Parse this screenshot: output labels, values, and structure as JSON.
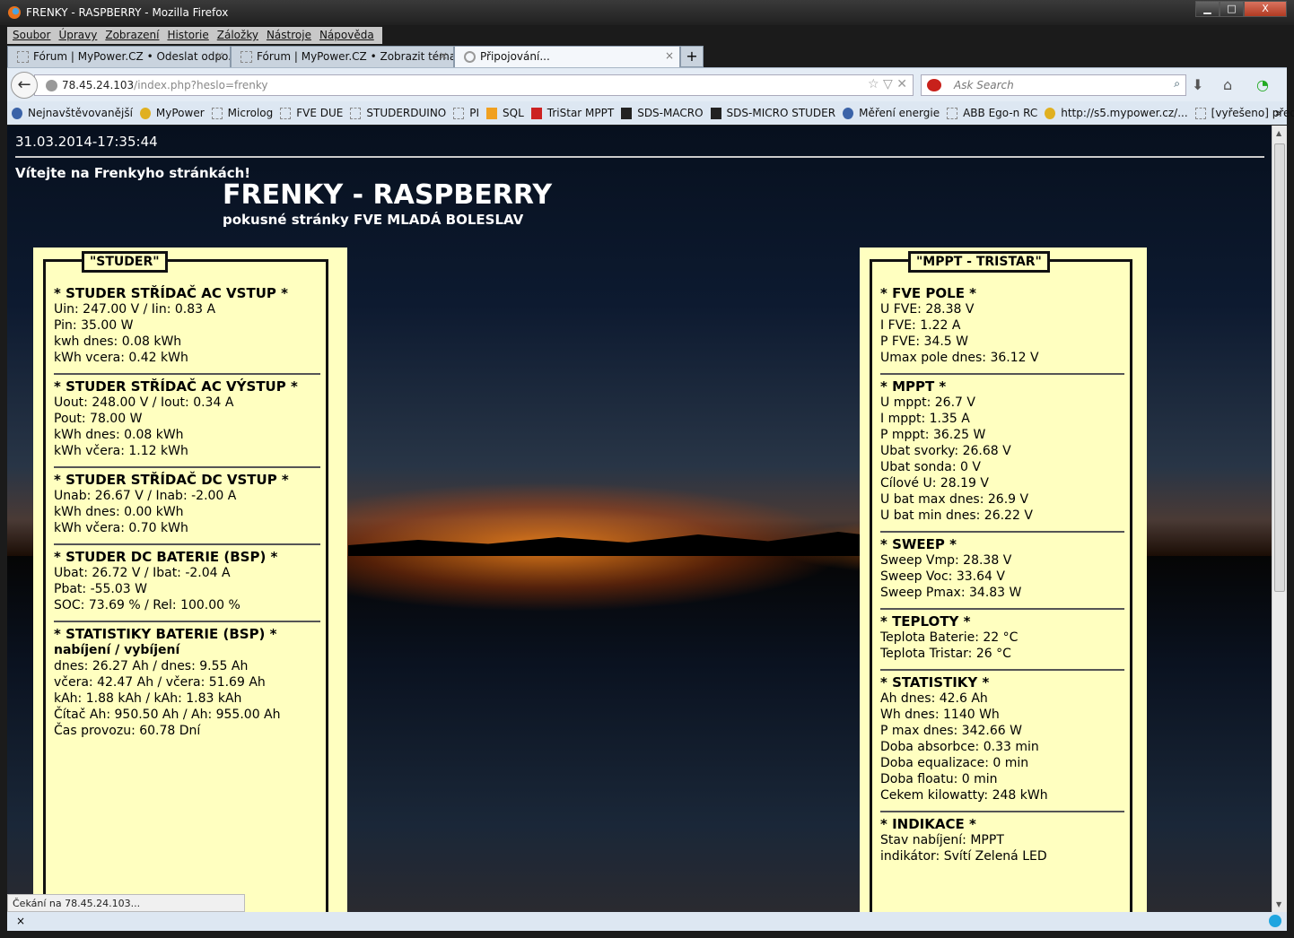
{
  "window": {
    "title": "FRENKY - RASPBERRY - Mozilla Firefox"
  },
  "menu": [
    "Soubor",
    "Úpravy",
    "Zobrazení",
    "Historie",
    "Záložky",
    "Nástroje",
    "Nápověda"
  ],
  "tabs": [
    {
      "label": "Fórum | MyPower.CZ • Odeslat odpo..."
    },
    {
      "label": "Fórum | MyPower.CZ • Zobrazit téma..."
    },
    {
      "label": "Připojování..."
    }
  ],
  "address": {
    "host": "78.45.24.103",
    "path": "/index.php?heslo=frenky"
  },
  "search": {
    "placeholder": "Ask Search"
  },
  "bookmarks": [
    "Nejnavštěvovanější",
    "MyPower",
    "Microlog",
    "FVE DUE",
    "STUDERDUINO",
    "PI",
    "SQL",
    "TriStar MPPT",
    "SDS-MACRO",
    "SDS-MICRO STUDER",
    "Měření energie",
    "ABB Ego-n RC",
    "http://s5.mypower.cz/...",
    "[vyřešeno] předávání d..."
  ],
  "page": {
    "datetime": "31.03.2014-17:35:44",
    "welcome": "Vítejte na Frenkyho stránkách!",
    "title": "FRENKY - RASPBERRY",
    "subtitle": "pokusné stránky FVE MLADÁ BOLESLAV",
    "studer": {
      "legend": "\"STUDER\"",
      "sections": [
        {
          "title": "* STUDER STŘÍDAČ AC VSTUP *",
          "lines": [
            "Uin: 247.00 V / Iin: 0.83 A",
            "Pin: 35.00 W",
            "kwh dnes: 0.08 kWh",
            "kWh vcera: 0.42 kWh"
          ]
        },
        {
          "title": "* STUDER STŘÍDAČ AC VÝSTUP *",
          "lines": [
            "Uout: 248.00 V / Iout: 0.34 A",
            "Pout: 78.00 W",
            "kWh dnes: 0.08 kWh",
            "kWh včera: 1.12 kWh"
          ]
        },
        {
          "title": "* STUDER STŘÍDAČ DC VSTUP *",
          "lines": [
            "Unab: 26.67 V / Inab: -2.00 A",
            "kWh dnes: 0.00 kWh",
            "kWh včera: 0.70 kWh"
          ]
        },
        {
          "title": "* STUDER DC BATERIE (BSP) *",
          "lines": [
            "Ubat: 26.72 V / Ibat: -2.04 A",
            "Pbat: -55.03 W",
            "SOC: 73.69 % / Rel: 100.00 %"
          ]
        },
        {
          "title": "* STATISTIKY BATERIE (BSP) *",
          "bold": "nabíjení / vybíjení",
          "lines": [
            "dnes: 26.27 Ah / dnes: 9.55 Ah",
            "včera: 42.47 Ah / včera: 51.69 Ah",
            "kAh: 1.88 kAh / kAh: 1.83 kAh",
            "Čítač Ah: 950.50 Ah / Ah: 955.00 Ah",
            "Čas provozu: 60.78 Dní"
          ]
        }
      ]
    },
    "tristar": {
      "legend": "\"MPPT - TRISTAR\"",
      "sections": [
        {
          "title": "* FVE POLE *",
          "lines": [
            "U FVE: 28.38 V",
            "I FVE: 1.22 A",
            "P FVE: 34.5 W",
            "Umax pole dnes: 36.12 V"
          ]
        },
        {
          "title": "* MPPT *",
          "lines": [
            "U mppt: 26.7 V",
            "I mppt: 1.35 A",
            "P mppt: 36.25 W",
            "Ubat svorky: 26.68 V",
            "Ubat sonda: 0 V",
            "Cílové U: 28.19 V",
            "U bat max dnes: 26.9 V",
            "U bat min dnes: 26.22 V"
          ]
        },
        {
          "title": "* SWEEP *",
          "lines": [
            "Sweep Vmp: 28.38 V",
            "Sweep Voc: 33.64 V",
            "Sweep Pmax: 34.83 W"
          ]
        },
        {
          "title": "* TEPLOTY *",
          "lines": [
            "Teplota Baterie: 22 °C",
            "Teplota Tristar: 26 °C"
          ]
        },
        {
          "title": "* STATISTIKY *",
          "lines": [
            "Ah dnes: 42.6 Ah",
            "Wh dnes: 1140 Wh",
            "P max dnes: 342.66 W",
            "Doba absorbce: 0.33 min",
            "Doba equalizace: 0 min",
            "Doba floatu: 0 min",
            "Cekem kilowatty: 248 kWh"
          ]
        },
        {
          "title": "* INDIKACE *",
          "lines": [
            "Stav nabíjení: MPPT",
            "indikátor: Svítí Zelená LED"
          ]
        }
      ]
    }
  },
  "status": "Čekání na 78.45.24.103...",
  "addonbar": {
    "close": "×"
  }
}
